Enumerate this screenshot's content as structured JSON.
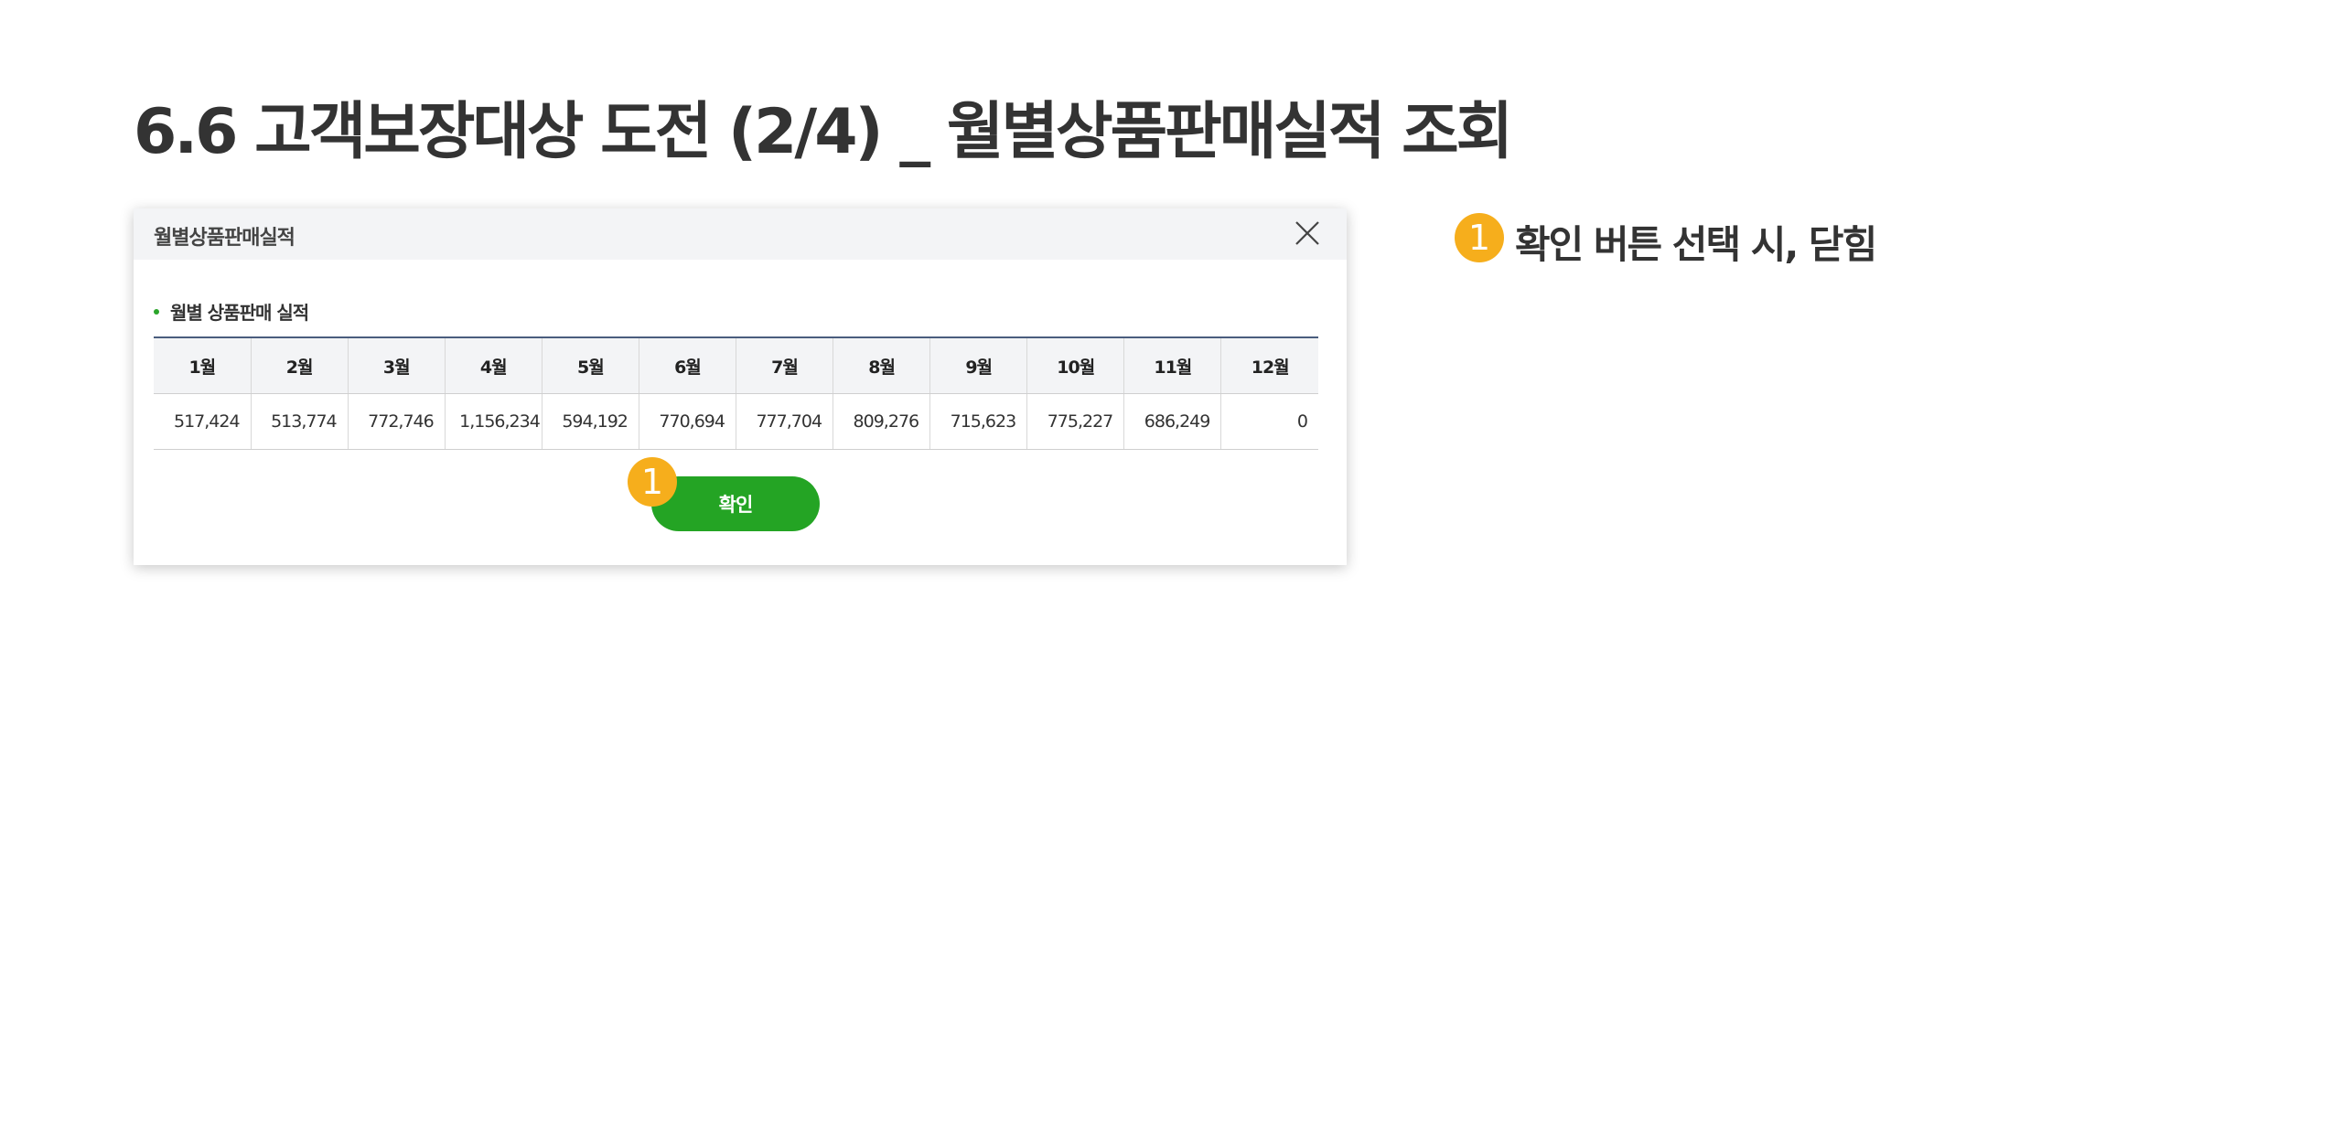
{
  "page_title": "6.6 고객보장대상 도전 (2/4) _ 월별상품판매실적 조회",
  "dialog": {
    "title": "월별상품판매실적",
    "close_icon": "close-icon",
    "section_title": "월별 상품판매 실적",
    "table": {
      "headers": [
        "1월",
        "2월",
        "3월",
        "4월",
        "5월",
        "6월",
        "7월",
        "8월",
        "9월",
        "10월",
        "11월",
        "12월"
      ],
      "values": [
        "517,424",
        "513,774",
        "772,746",
        "1,156,234",
        "594,192",
        "770,694",
        "777,704",
        "809,276",
        "715,623",
        "775,227",
        "686,249",
        "0"
      ]
    },
    "confirm_label": "확인",
    "marker_number": "1"
  },
  "annotation": {
    "marker_number": "1",
    "text": "확인 버튼 선택 시, 닫힘"
  },
  "colors": {
    "confirm_button": "#24a424",
    "marker": "#f6ae1c",
    "table_top_border": "#4a5d7e",
    "header_bg": "#f3f4f6"
  }
}
